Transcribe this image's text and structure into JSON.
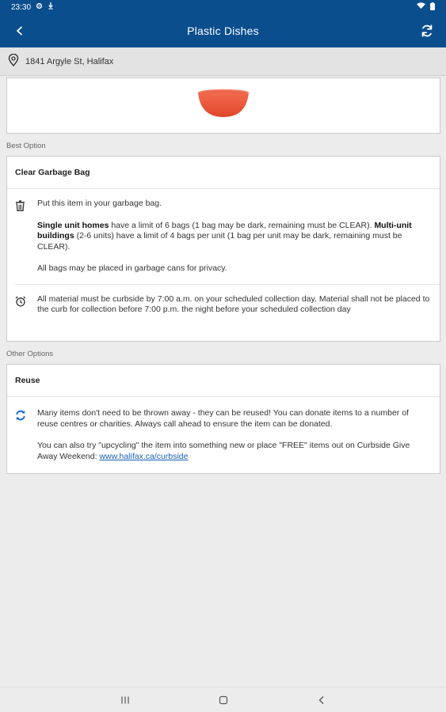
{
  "status_bar": {
    "time": "23:30",
    "icons": [
      "gear-icon",
      "download-icon",
      "wifi-icon",
      "battery-icon"
    ]
  },
  "header": {
    "title": "Plastic Dishes",
    "back_icon": "back-icon",
    "refresh_icon": "refresh-icon"
  },
  "address": {
    "icon": "location-pin-icon",
    "text": "1841 Argyle St, Halifax"
  },
  "item_image": {
    "description_icon": "bowl-image",
    "color": "#f05a3e"
  },
  "best_option": {
    "section_label": "Best Option",
    "title": "Clear Garbage Bag",
    "rows": [
      {
        "icon": "garbage-can-icon",
        "intro": "Put this item in your garbage bag.",
        "single_label": "Single unit homes",
        "single_text": " have a limit of 6 bags (1 bag may be dark, remaining must be CLEAR). ",
        "multi_label": "Multi-unit buildings",
        "multi_text": " (2-6 units) have a limit of 4 bags per unit (1 bag per unit may be dark, remaining must be CLEAR).",
        "privacy": "All bags may be placed in garbage cans for privacy."
      },
      {
        "icon": "alarm-clock-icon",
        "text": "All material must be curbside by 7:00 a.m. on your scheduled collection day. Material shall not be placed to the curb for collection before 7:00 p.m. the night before your scheduled collection day"
      }
    ]
  },
  "other_options": {
    "section_label": "Other Options",
    "title": "Reuse",
    "icon": "reuse-icon",
    "paragraph1": "Many items don't need to be thrown away - they can be reused! You can donate items to a number of reuse centres or charities. Always call ahead to ensure the item can be donated.",
    "paragraph2_prefix": "You can also try \"upcycling\" the item into something new or place \"FREE\" items out on Curbside Give Away Weekend: ",
    "link_text": "www.halifax.ca/curbside"
  },
  "nav_bar": {
    "icons": [
      "recent-apps-icon",
      "home-icon",
      "nav-back-icon"
    ]
  },
  "colors": {
    "primary": "#0a4e8e",
    "reuse_blue": "#1f6fd6",
    "link": "#1a5fb4"
  }
}
